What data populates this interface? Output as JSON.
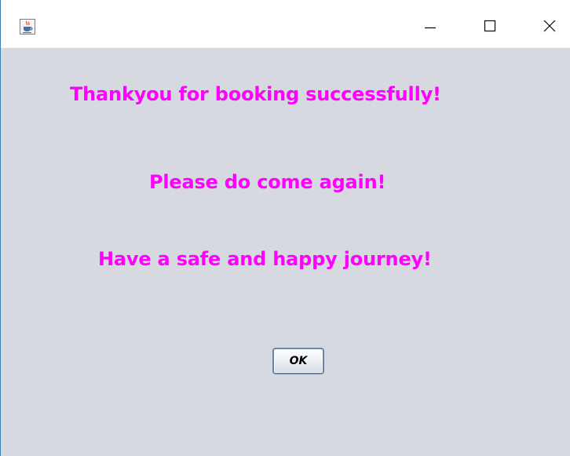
{
  "window": {
    "title": "",
    "icons": {
      "app": "java-cup-icon",
      "minimize": "minimize-icon",
      "maximize": "maximize-icon",
      "close": "close-icon"
    }
  },
  "dialog": {
    "messages": [
      "Thankyou for booking successfully!",
      "Please do come again!",
      "Have a safe and happy journey!"
    ],
    "ok_label": "OK"
  },
  "colors": {
    "message_text": "#ff00ff",
    "client_background": "#d6d9e0",
    "titlebar_background": "#ffffff",
    "button_border": "#6a84a8"
  }
}
